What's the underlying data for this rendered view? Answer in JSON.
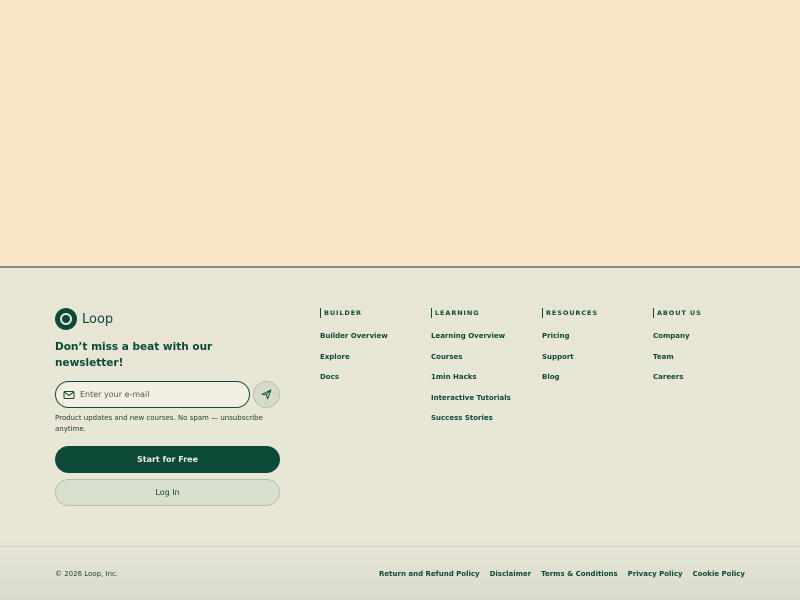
{
  "brand": {
    "name": "Loop",
    "logo_icon": "circle-logo-icon"
  },
  "newsletter": {
    "headline": "Don’t miss a beat with our newsletter!",
    "email_placeholder": "Enter your e-mail",
    "email_icon": "mail-icon",
    "send_icon": "send-icon",
    "note": "Product updates and new courses. No spam — unsubscribe anytime."
  },
  "actions": {
    "start_label": "Start for Free",
    "login_label": "Log In"
  },
  "columns": [
    {
      "heading": "BUILDER",
      "links": [
        "Builder Overview",
        "Explore",
        "Docs"
      ]
    },
    {
      "heading": "LEARNING",
      "links": [
        "Learning Overview",
        "Courses",
        "1min Hacks",
        "Interactive Tutorials",
        "Success Stories"
      ]
    },
    {
      "heading": "RESOURCES",
      "links": [
        "Pricing",
        "Support",
        "Blog"
      ]
    },
    {
      "heading": "ABOUT US",
      "links": [
        "Company",
        "Team",
        "Careers"
      ]
    }
  ],
  "bottom": {
    "copyright": "© 2026 Loop, Inc.",
    "legal_links": [
      "Return and Refund Policy",
      "Disclaimer",
      "Terms & Conditions",
      "Privacy Policy",
      "Cookie Policy"
    ]
  },
  "colors": {
    "brand_green": "#0b4a37",
    "hero_background": "#f7e6c7",
    "footer_background": "#e7e5d3"
  }
}
